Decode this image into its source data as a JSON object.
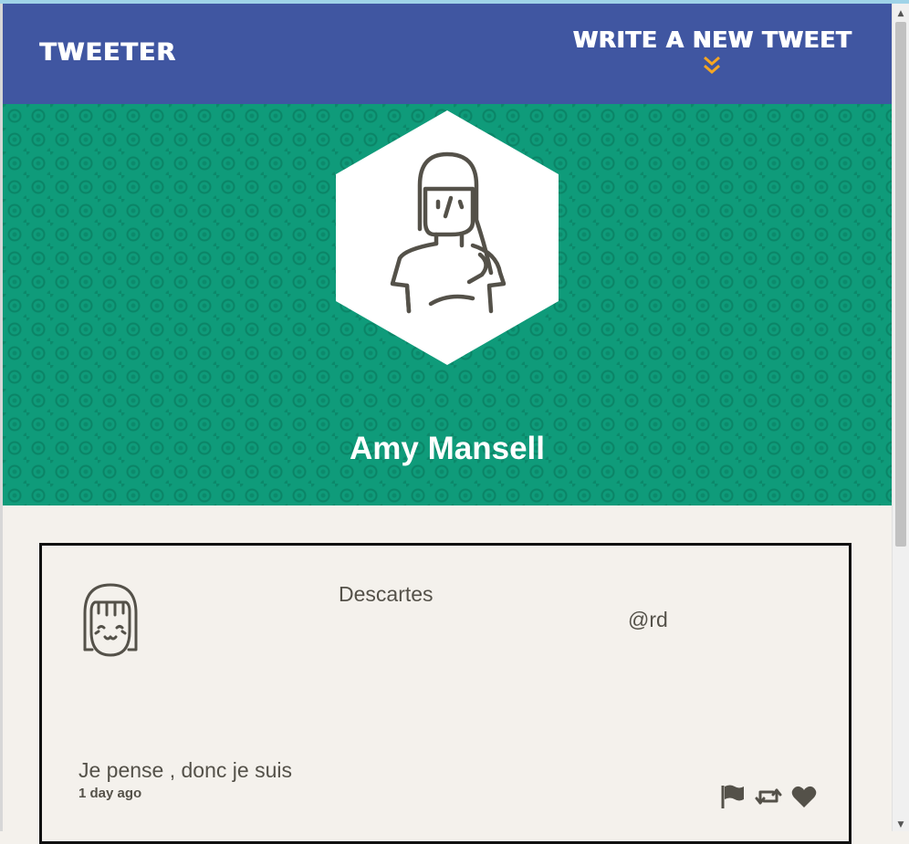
{
  "nav": {
    "brand": "TWEETER",
    "compose_label": "WRITE A NEW TWEET",
    "compose_icon": "double-chevron-down-icon",
    "compose_icon_color": "#f5a623"
  },
  "profile": {
    "name": "Amy Mansell",
    "avatar_icon": "woman-avatar-icon",
    "background_color": "#0f9b7a"
  },
  "tweet": {
    "avatar_icon": "girl-face-avatar-icon",
    "author_name": "Descartes",
    "handle": "@rd",
    "text": "Je pense , donc je suis",
    "timestamp": "1 day ago",
    "actions": [
      "flag-icon",
      "retweet-icon",
      "heart-icon"
    ]
  },
  "colors": {
    "nav": "#4056a1",
    "page_background": "#f4f1ec",
    "text": "#545149",
    "accent": "#f5a623"
  }
}
